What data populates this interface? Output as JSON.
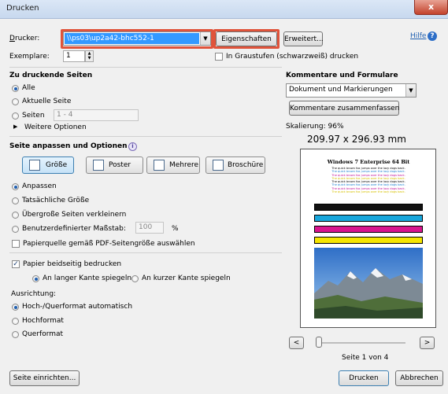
{
  "window": {
    "title": "Drucken",
    "close_glyph": "x"
  },
  "printer": {
    "label": "Drucker:",
    "selected": "\\\\ps03\\up2a42-bhc552-1",
    "properties_btn": "Eigenschaften",
    "advanced_btn": "Erweitert...",
    "help_link": "Hilfe"
  },
  "copies": {
    "label": "Exemplare:",
    "value": "1",
    "grayscale_label": "In Graustufen (schwarzweiß) drucken"
  },
  "pages": {
    "header": "Zu druckende Seiten",
    "all": "Alle",
    "current": "Aktuelle Seite",
    "pages_label": "Seiten",
    "pages_value": "1 - 4",
    "more_options": "Weitere Optionen"
  },
  "sizing": {
    "header": "Seite anpassen und Optionen",
    "modes": [
      "Größe",
      "Poster",
      "Mehrere",
      "Broschüre"
    ],
    "fit": "Anpassen",
    "actual": "Tatsächliche Größe",
    "shrink": "Übergroße Seiten verkleinern",
    "custom": "Benutzerdefinierter Maßstab:",
    "custom_value": "100",
    "percent": "%",
    "paper_source": "Papierquelle gemäß PDF-Seitengröße auswählen"
  },
  "duplex": {
    "label": "Papier beidseitig bedrucken",
    "long_edge": "An langer Kante spiegeln",
    "short_edge": "An kurzer Kante spiegeln"
  },
  "orientation": {
    "label": "Ausrichtung:",
    "auto": "Hoch-/Querformat automatisch",
    "portrait": "Hochformat",
    "landscape": "Querformat"
  },
  "comments": {
    "header": "Kommentare und Formulare",
    "selected": "Dokument und Markierungen",
    "summarize_btn": "Kommentare zusammenfassen"
  },
  "preview": {
    "scale": "Skalierung: 96%",
    "size": "209.97 x 296.93 mm",
    "doc_title": "Windows 7 Enterprise 64 Bit",
    "sample_line": "The quick brown fox jumps over the lazy dogs back.",
    "page_info": "Seite 1 von 4",
    "prev": "<",
    "next": ">",
    "slider_pos": 0.0
  },
  "footer": {
    "page_setup": "Seite einrichten...",
    "print": "Drucken",
    "cancel": "Abbrechen"
  },
  "colors": {
    "accent": "#1f5fb0",
    "highlight": "#e0533a"
  }
}
